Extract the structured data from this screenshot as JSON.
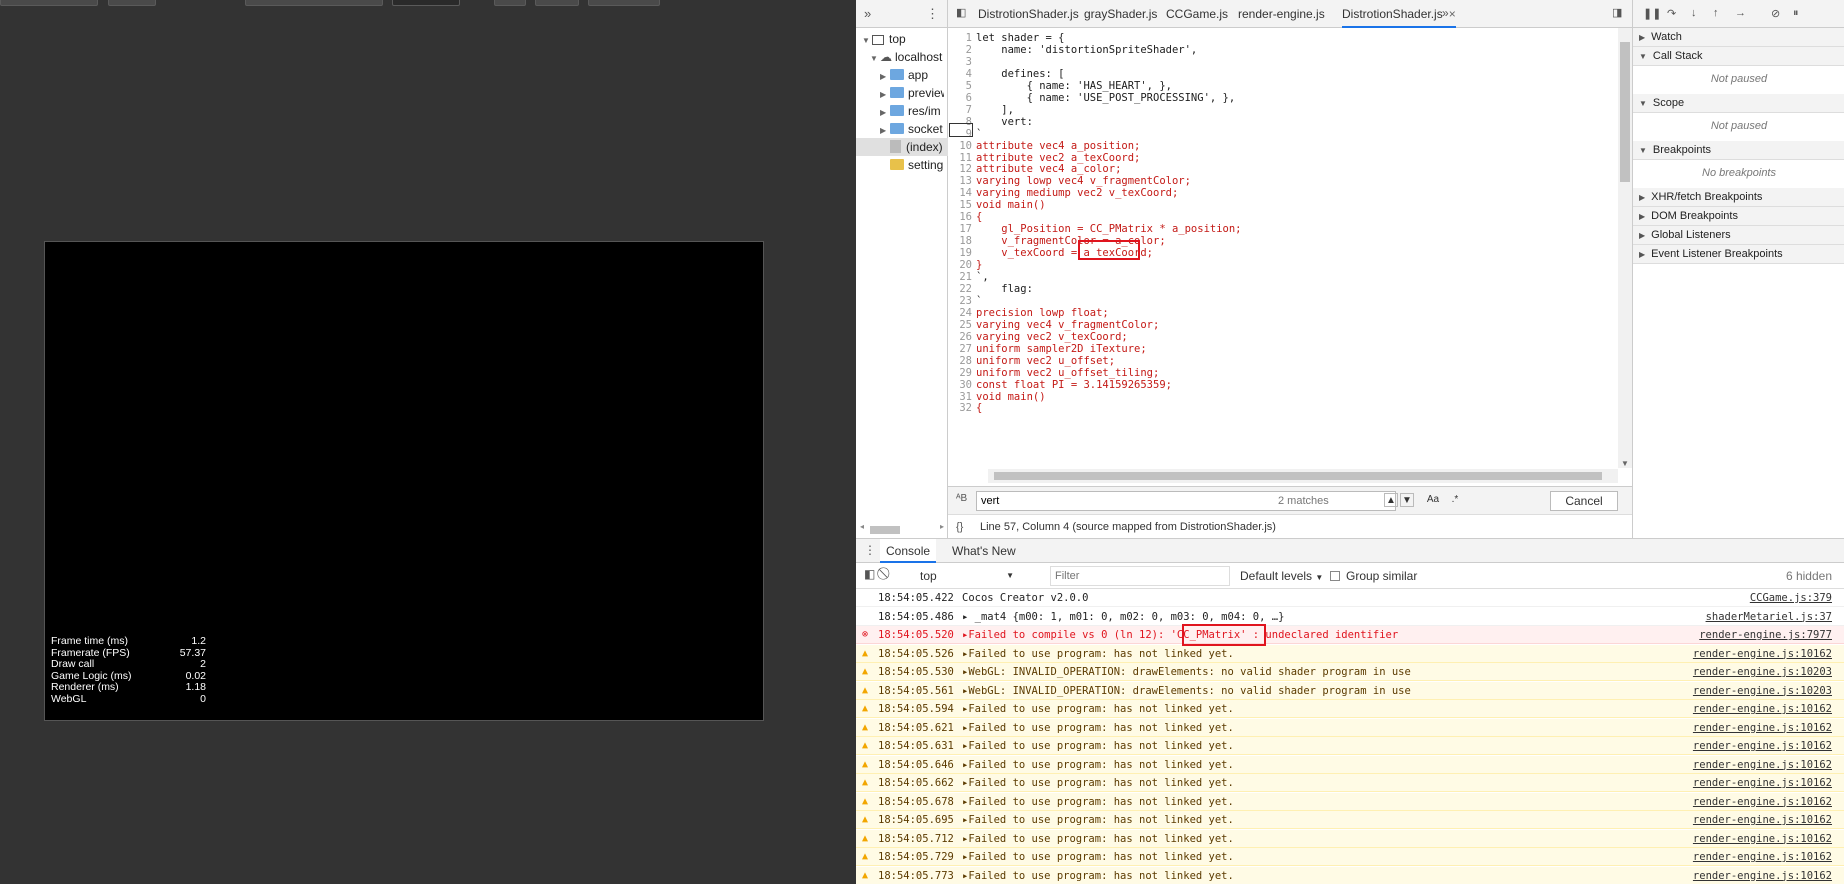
{
  "preview": {
    "stats": [
      {
        "label": "Frame time (ms)",
        "value": "1.2"
      },
      {
        "label": "Framerate (FPS)",
        "value": "57.37"
      },
      {
        "label": "Draw call",
        "value": "2"
      },
      {
        "label": "Game Logic (ms)",
        "value": "0.02"
      },
      {
        "label": "Renderer (ms)",
        "value": "1.18"
      },
      {
        "label": "WebGL",
        "value": "0"
      }
    ]
  },
  "navigator": {
    "items": [
      {
        "label": "top",
        "type": "frame"
      },
      {
        "label": "localhost",
        "type": "cloud"
      },
      {
        "label": "app",
        "type": "folder"
      },
      {
        "label": "preview",
        "type": "folder"
      },
      {
        "label": "res/im",
        "type": "folder"
      },
      {
        "label": "socket",
        "type": "folder"
      },
      {
        "label": "(index)",
        "type": "file"
      },
      {
        "label": "setting",
        "type": "folder-yellow"
      }
    ]
  },
  "editor": {
    "tabs": [
      {
        "label": "DistrotionShader.js",
        "active": false
      },
      {
        "label": "grayShader.js",
        "active": false
      },
      {
        "label": "CCGame.js",
        "active": false
      },
      {
        "label": "render-engine.js",
        "active": false
      },
      {
        "label": "DistrotionShader.js",
        "active": true
      }
    ],
    "lines": [
      {
        "n": "1",
        "t": "let shader = {",
        "red": false
      },
      {
        "n": "2",
        "t": "    name: 'distortionSpriteShader',",
        "red": false
      },
      {
        "n": "3",
        "t": "",
        "red": false
      },
      {
        "n": "4",
        "t": "    defines: [",
        "red": false
      },
      {
        "n": "5",
        "t": "        { name: 'HAS_HEART', },",
        "red": false
      },
      {
        "n": "6",
        "t": "        { name: 'USE_POST_PROCESSING', },",
        "red": false
      },
      {
        "n": "7",
        "t": "    ],",
        "red": false
      },
      {
        "n": "8",
        "t": "    vert:",
        "red": false
      },
      {
        "n": "9",
        "t": "`",
        "red": false
      },
      {
        "n": "10",
        "t": "attribute vec4 a_position;",
        "red": true
      },
      {
        "n": "11",
        "t": "attribute vec2 a_texCoord;",
        "red": true
      },
      {
        "n": "12",
        "t": "attribute vec4 a_color;",
        "red": true
      },
      {
        "n": "13",
        "t": "varying lowp vec4 v_fragmentColor;",
        "red": true
      },
      {
        "n": "14",
        "t": "varying mediump vec2 v_texCoord;",
        "red": true
      },
      {
        "n": "15",
        "t": "void main()",
        "red": true
      },
      {
        "n": "16",
        "t": "{",
        "red": true
      },
      {
        "n": "17",
        "t": "    gl_Position = CC_PMatrix * a_position;",
        "red": true
      },
      {
        "n": "18",
        "t": "    v_fragmentColor = a_color;",
        "red": true
      },
      {
        "n": "19",
        "t": "    v_texCoord = a_texCoord;",
        "red": true
      },
      {
        "n": "20",
        "t": "}",
        "red": true
      },
      {
        "n": "21",
        "t": "`,",
        "red": false
      },
      {
        "n": "22",
        "t": "    flag:",
        "red": false
      },
      {
        "n": "23",
        "t": "`",
        "red": false
      },
      {
        "n": "24",
        "t": "precision lowp float;",
        "red": true
      },
      {
        "n": "25",
        "t": "varying vec4 v_fragmentColor;",
        "red": true
      },
      {
        "n": "26",
        "t": "varying vec2 v_texCoord;",
        "red": true
      },
      {
        "n": "27",
        "t": "uniform sampler2D iTexture;",
        "red": true
      },
      {
        "n": "28",
        "t": "uniform vec2 u_offset;",
        "red": true
      },
      {
        "n": "29",
        "t": "uniform vec2 u_offset_tiling;",
        "red": true
      },
      {
        "n": "30",
        "t": "const float PI = 3.14159265359;",
        "red": true
      },
      {
        "n": "31",
        "t": "void main()",
        "red": true
      },
      {
        "n": "32",
        "t": "{",
        "red": true
      }
    ],
    "search": {
      "value": "vert",
      "count": "2 matches",
      "aa": "Aa",
      "regex": ".*",
      "cancel": "Cancel"
    },
    "status": {
      "braces": "{}",
      "text": "Line 57, Column 4  (source mapped from DistrotionShader.js)"
    }
  },
  "debugger": {
    "panes": [
      {
        "title": "Watch",
        "body": ""
      },
      {
        "title": "Call Stack",
        "body": "Not paused"
      },
      {
        "title": "Scope",
        "body": "Not paused"
      },
      {
        "title": "Breakpoints",
        "body": "No breakpoints"
      },
      {
        "title": "XHR/fetch Breakpoints",
        "body": ""
      },
      {
        "title": "DOM Breakpoints",
        "body": ""
      },
      {
        "title": "Global Listeners",
        "body": ""
      },
      {
        "title": "Event Listener Breakpoints",
        "body": ""
      }
    ]
  },
  "console": {
    "tabs": [
      {
        "label": "Console",
        "active": true
      },
      {
        "label": "What's New",
        "active": false
      }
    ],
    "context": "top",
    "filter_placeholder": "Filter",
    "levels": "Default levels",
    "group_similar": "Group similar",
    "hidden": "6 hidden",
    "messages": [
      {
        "level": "info",
        "ts": "18:54:05.422",
        "body": "Cocos Creator v2.0.0",
        "src": "CCGame.js:379"
      },
      {
        "level": "info",
        "ts": "18:54:05.486",
        "body": "▸ _mat4 {m00: 1, m01: 0, m02: 0, m03: 0, m04: 0, …}",
        "src": "shaderMetariel.js:37"
      },
      {
        "level": "error",
        "ts": "18:54:05.520",
        "body": "▸Failed to compile vs 0 (ln 12): 'CC_PMatrix' : undeclared identifier",
        "src": "render-engine.js:7977"
      },
      {
        "level": "warn",
        "ts": "18:54:05.526",
        "body": "▸Failed to use program: has not linked yet.",
        "src": "render-engine.js:10162"
      },
      {
        "level": "warn",
        "ts": "18:54:05.530",
        "body": "▸WebGL: INVALID_OPERATION: drawElements: no valid shader program in use",
        "src": "render-engine.js:10203"
      },
      {
        "level": "warn",
        "ts": "18:54:05.561",
        "body": "▸WebGL: INVALID_OPERATION: drawElements: no valid shader program in use",
        "src": "render-engine.js:10203"
      },
      {
        "level": "warn",
        "ts": "18:54:05.594",
        "body": "▸Failed to use program: has not linked yet.",
        "src": "render-engine.js:10162"
      },
      {
        "level": "warn",
        "ts": "18:54:05.621",
        "body": "▸Failed to use program: has not linked yet.",
        "src": "render-engine.js:10162"
      },
      {
        "level": "warn",
        "ts": "18:54:05.631",
        "body": "▸Failed to use program: has not linked yet.",
        "src": "render-engine.js:10162"
      },
      {
        "level": "warn",
        "ts": "18:54:05.646",
        "body": "▸Failed to use program: has not linked yet.",
        "src": "render-engine.js:10162"
      },
      {
        "level": "warn",
        "ts": "18:54:05.662",
        "body": "▸Failed to use program: has not linked yet.",
        "src": "render-engine.js:10162"
      },
      {
        "level": "warn",
        "ts": "18:54:05.678",
        "body": "▸Failed to use program: has not linked yet.",
        "src": "render-engine.js:10162"
      },
      {
        "level": "warn",
        "ts": "18:54:05.695",
        "body": "▸Failed to use program: has not linked yet.",
        "src": "render-engine.js:10162"
      },
      {
        "level": "warn",
        "ts": "18:54:05.712",
        "body": "▸Failed to use program: has not linked yet.",
        "src": "render-engine.js:10162"
      },
      {
        "level": "warn",
        "ts": "18:54:05.729",
        "body": "▸Failed to use program: has not linked yet.",
        "src": "render-engine.js:10162"
      },
      {
        "level": "warn",
        "ts": "18:54:05.773",
        "body": "▸Failed to use program: has not linked yet.",
        "src": "render-engine.js:10162"
      }
    ]
  },
  "colors": {
    "error": "#e0141e",
    "warn": "#f2a600",
    "accent": "#1a73e8"
  }
}
